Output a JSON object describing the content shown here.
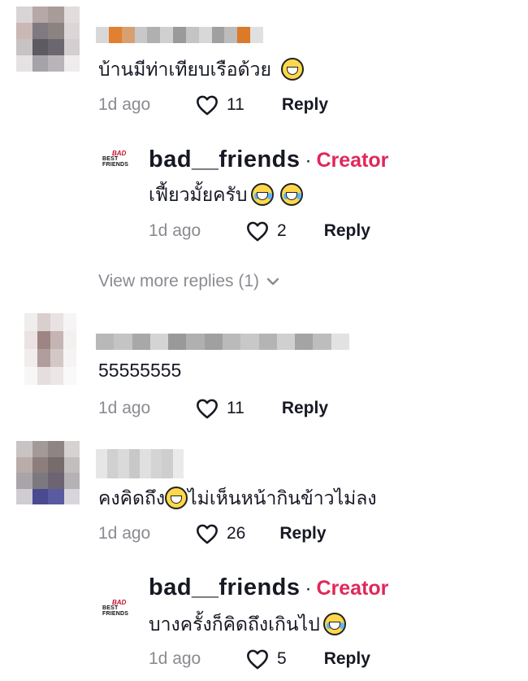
{
  "comments": [
    {
      "text": "บ้านมีท่าเทียบเรือด้วย",
      "time": "1d ago",
      "likes": "11",
      "reply_label": "Reply",
      "avatar_colors": [
        "#d9d4d6",
        "#b5a8a6",
        "#a89c99",
        "#e2dcdd",
        "#c9b8b3",
        "#7e7a80",
        "#8b8380",
        "#dcd6d8",
        "#c7c2c4",
        "#5e5a62",
        "#6b6770",
        "#d3cfd1",
        "#e5e2e3",
        "#a5a2a8",
        "#b8b4b9",
        "#eeeced"
      ],
      "name_colors": [
        "#d8d8d8",
        "#e08030",
        "#d8a070",
        "#c8c8c8",
        "#b0b0b0",
        "#d0d0d0",
        "#9a9a9a",
        "#c4c4c4",
        "#d8d8d8",
        "#a0a0a0",
        "#bcbcbc",
        "#dc7a2a",
        "#e0e0e0"
      ]
    },
    {
      "text": "55555555",
      "time": "1d ago",
      "likes": "11",
      "reply_label": "Reply",
      "avatar_colors": [
        "#f0eded",
        "#d9cfcf",
        "#e8e2e2",
        "#f6f4f4",
        "#ebe3e3",
        "#9e8584",
        "#c4b5b4",
        "#f3f0f0",
        "#f2eded",
        "#b09d9c",
        "#d4c8c7",
        "#f5f3f3",
        "#f8f6f6",
        "#e6dede",
        "#ece6e6",
        "#faf9f9"
      ],
      "name_colors": [
        "#b8b8b8",
        "#c4c4c4",
        "#a8a8a8",
        "#d4d4d4",
        "#999999",
        "#b0b0b0",
        "#a0a0a0",
        "#bababa",
        "#c8c8c8",
        "#b4b4b4",
        "#d0d0d0",
        "#a4a4a4",
        "#bdbdbd",
        "#e2e2e2"
      ]
    },
    {
      "text": "คงคิดถึง",
      "text2": "ไม่เห็นหน้ากินข้าวไม่ลง",
      "time": "1d ago",
      "likes": "26",
      "reply_label": "Reply",
      "avatar_colors": [
        "#c9c4c4",
        "#a39a98",
        "#8d8483",
        "#d6d2d2",
        "#b9aca9",
        "#8c7f7b",
        "#766c6c",
        "#c3bebe",
        "#a8a4a8",
        "#7c7880",
        "#6c6472",
        "#b5b2b6",
        "#d0cdd2",
        "#4a4a90",
        "#5a5aa0",
        "#d8d6dc"
      ],
      "name_colors": [
        "#e6e6e6",
        "#d0d0d0",
        "#dadada",
        "#c8c8c8",
        "#e0e0e0",
        "#d4d4d4",
        "#cecece",
        "#eaeaea"
      ]
    }
  ],
  "replies": [
    {
      "logo_line1": "BAD",
      "logo_line2": "BEST FRIENDS",
      "name": "bad__friends",
      "separator": "·",
      "badge": "Creator",
      "text": "เฟี้ยวมั้ยครับ",
      "time": "1d ago",
      "likes": "2",
      "reply_label": "Reply"
    },
    {
      "logo_line1": "BAD",
      "logo_line2": "BEST FRIENDS",
      "name": "bad__friends",
      "separator": "·",
      "badge": "Creator",
      "text": "บางครั้งก็คิดถึงเกินไป",
      "time": "1d ago",
      "likes": "5",
      "reply_label": "Reply"
    }
  ],
  "view_more": "View more replies (1)",
  "icons": {
    "like": "heart-outline-icon",
    "expand": "chevron-down-icon",
    "emoji_grin": "grinning-emoji-icon",
    "emoji_joy": "tears-of-joy-emoji-icon",
    "emoji_sweat": "grinning-sweat-emoji-icon"
  },
  "colors": {
    "creator_badge": "#e0285a",
    "meta_gray": "#8a8b91",
    "text": "#161823"
  }
}
